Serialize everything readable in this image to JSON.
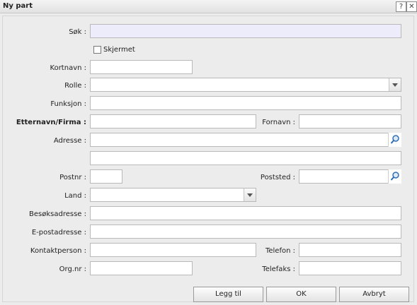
{
  "window": {
    "title": "Ny part",
    "help_glyph": "?",
    "close_glyph": "✕"
  },
  "form": {
    "sok": {
      "label": "Søk :",
      "value": ""
    },
    "skjermet": {
      "label": "Skjermet",
      "checked": false
    },
    "kortnavn": {
      "label": "Kortnavn :",
      "value": ""
    },
    "rolle": {
      "label": "Rolle :",
      "value": ""
    },
    "funksjon": {
      "label": "Funksjon :",
      "value": ""
    },
    "etternavn": {
      "label": "Etternavn/Firma :",
      "value": ""
    },
    "fornavn": {
      "label": "Fornavn :",
      "value": ""
    },
    "adresse": {
      "label": "Adresse :",
      "value": "",
      "value2": ""
    },
    "postnr": {
      "label": "Postnr :",
      "value": ""
    },
    "poststed": {
      "label": "Poststed :",
      "value": ""
    },
    "land": {
      "label": "Land :",
      "value": ""
    },
    "besoksadresse": {
      "label": "Besøksadresse :",
      "value": ""
    },
    "epostadresse": {
      "label": "E-postadresse :",
      "value": ""
    },
    "kontaktperson": {
      "label": "Kontaktperson :",
      "value": ""
    },
    "telefon": {
      "label": "Telefon :",
      "value": ""
    },
    "orgnr": {
      "label": "Org.nr :",
      "value": ""
    },
    "telefaks": {
      "label": "Telefaks :",
      "value": ""
    }
  },
  "buttons": {
    "add": "Legg til",
    "ok": "OK",
    "cancel": "Avbryt"
  }
}
